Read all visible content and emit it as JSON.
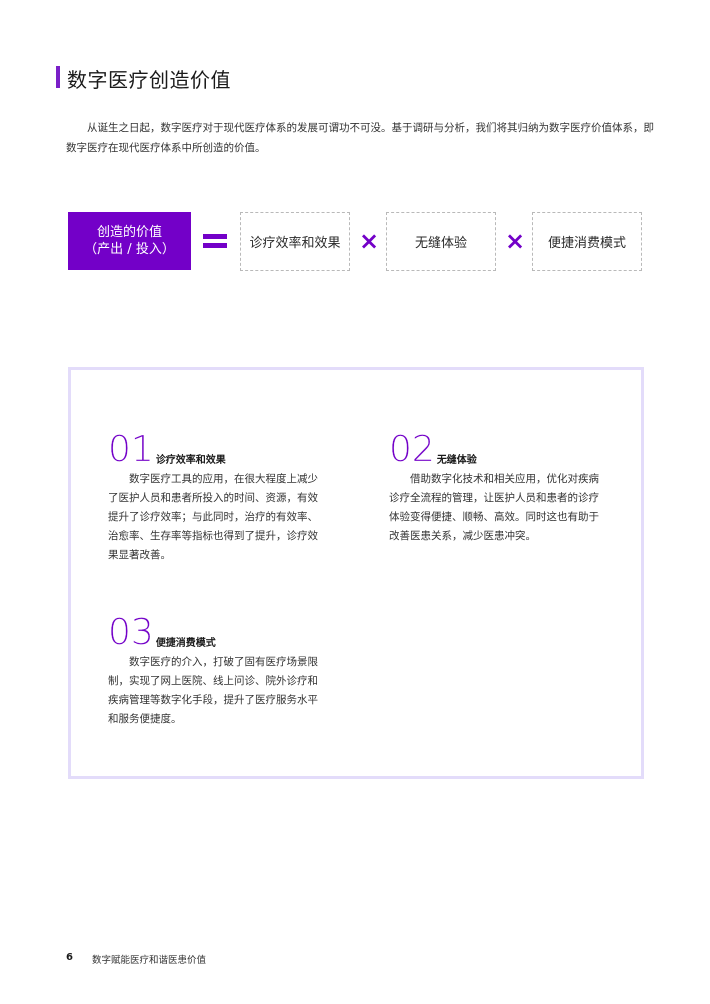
{
  "heading": "数字医疗创造价值",
  "intro": "从诞生之日起，数字医疗对于现代医疗体系的发展可谓功不可没。基于调研与分析，我们将其归纳为数字医疗价值体系，即数字医疗在现代医疗体系中所创造的价值。",
  "formula": {
    "main_line1": "创造的价值",
    "main_line2": "（产出 / 投入）",
    "equals": "=",
    "times": "×",
    "factors": [
      "诊疗效率和效果",
      "无缝体验",
      "便捷消费模式"
    ]
  },
  "items": [
    {
      "num": "01",
      "title": "诊疗效率和效果",
      "body": "数字医疗工具的应用，在很大程度上减少了医护人员和患者所投入的时间、资源，有效提升了诊疗效率；与此同时，治疗的有效率、治愈率、生存率等指标也得到了提升，诊疗效果显著改善。"
    },
    {
      "num": "02",
      "title": "无缝体验",
      "body": "借助数字化技术和相关应用，优化对疾病诊疗全流程的管理，让医护人员和患者的诊疗体验变得便捷、顺畅、高效。同时这也有助于改善医患关系，减少医患冲突。"
    },
    {
      "num": "03",
      "title": "便捷消费模式",
      "body": "数字医疗的介入，打破了固有医疗场景限制，实现了网上医院、线上问诊、院外诊疗和疾病管理等数字化手段，提升了医疗服务水平和服务便捷度。"
    }
  ],
  "footer": {
    "page_number": "6",
    "text": "数字赋能医疗和谐医患价值"
  },
  "colors": {
    "accent": "#7300c8",
    "panel_border": "#e3dcfa"
  }
}
